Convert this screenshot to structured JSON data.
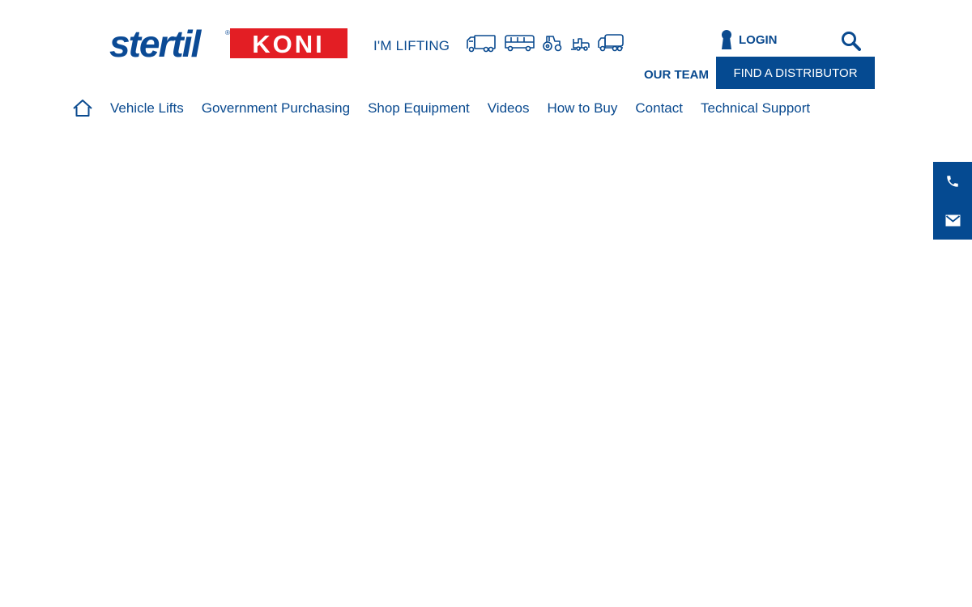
{
  "header": {
    "logo": {
      "brand_left": "stertil",
      "brand_right": "KONI",
      "registered_mark": "®"
    },
    "lifting_label": "I'M LIFTING",
    "vehicle_icons": [
      "truck-icon",
      "bus-icon",
      "tractor-icon",
      "forklift-icon",
      "tanker-truck-icon"
    ],
    "login_label": "LOGIN",
    "search_icon": "search-icon",
    "our_team_label": "OUR TEAM",
    "find_distributor_label": "FIND A DISTRIBUTOR"
  },
  "nav": {
    "home_icon": "home-icon",
    "items": [
      {
        "label": "Vehicle Lifts"
      },
      {
        "label": "Government Purchasing"
      },
      {
        "label": "Shop Equipment"
      },
      {
        "label": "Videos"
      },
      {
        "label": "How to Buy"
      },
      {
        "label": "Contact"
      },
      {
        "label": "Technical Support"
      }
    ]
  },
  "side_tabs": {
    "phone_icon": "phone-icon",
    "email_icon": "email-icon"
  },
  "colors": {
    "brand_blue": "#054a91",
    "link_blue": "#0a4a8f",
    "brand_red": "#e31e24",
    "background": "#ffffff"
  }
}
